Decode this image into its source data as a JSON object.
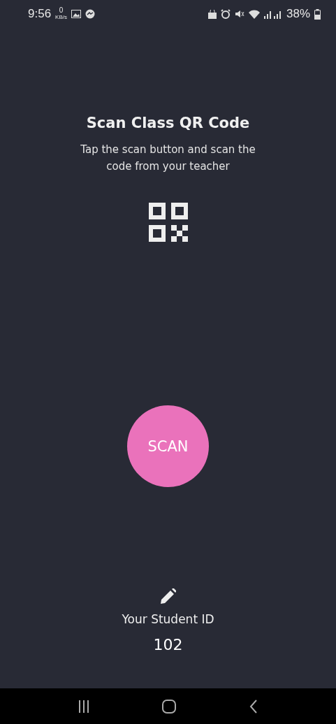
{
  "status_bar": {
    "time": "9:56",
    "speed_value": "0",
    "speed_unit": "KB/s",
    "battery": "38%"
  },
  "title": "Scan Class QR Code",
  "subtitle": "Tap the scan button and scan the code from your teacher",
  "scan_button": "SCAN",
  "student": {
    "label": "Your Student ID",
    "id": "102"
  }
}
